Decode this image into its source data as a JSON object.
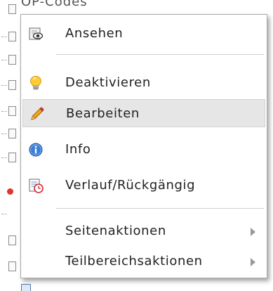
{
  "background": {
    "page_title": "OP-Codes"
  },
  "menu": {
    "items": [
      {
        "label": "Ansehen",
        "icon": "view-icon"
      },
      {
        "label": "Deaktivieren",
        "icon": "lightbulb-icon"
      },
      {
        "label": "Bearbeiten",
        "icon": "pencil-icon",
        "active": true
      },
      {
        "label": "Info",
        "icon": "info-icon"
      },
      {
        "label": "Verlauf/Rückgängig",
        "icon": "history-icon"
      },
      {
        "label": "Seitenaktionen",
        "submenu": true
      },
      {
        "label": "Teilbereichsaktionen",
        "submenu": true
      }
    ]
  },
  "colors": {
    "active_background": "#e6e6e6",
    "menu_border": "#a9a9a9",
    "text": "#222222",
    "submenu_arrow": "#999999"
  }
}
